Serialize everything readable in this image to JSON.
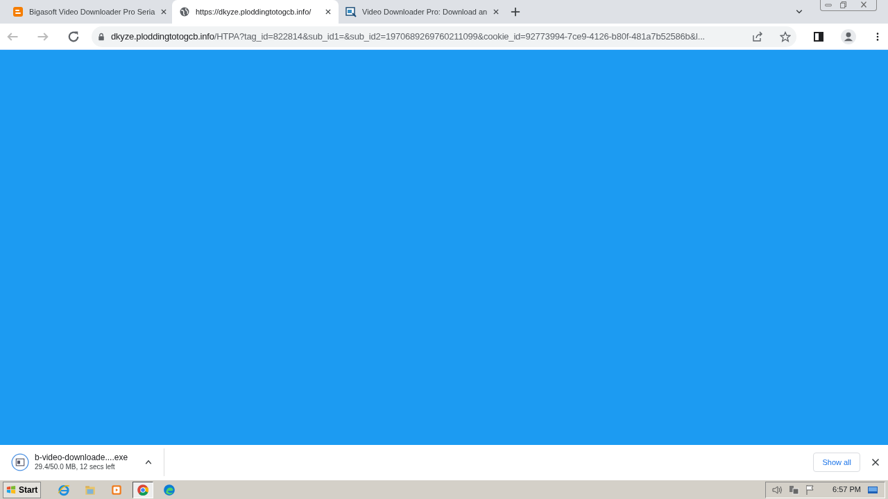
{
  "tabs": [
    {
      "title": "Bigasoft Video Downloader Pro Seria",
      "kind": "blogger",
      "selected": false
    },
    {
      "title": "https://dkyze.ploddingtotogcb.info/",
      "kind": "globe",
      "selected": true
    },
    {
      "title": "Video Downloader Pro: Download an",
      "kind": "app",
      "selected": false
    }
  ],
  "address_bar": {
    "host": "dkyze.ploddingtotogcb.info",
    "path": "/HTPA?tag_id=822814&sub_id1=&sub_id2=1970689269760211099&cookie_id=92773994-7ce9-4126-b80f-481a7b52586b&l..."
  },
  "download_bar": {
    "file_name": "b-video-downloade....exe",
    "status": "29.4/50.0 MB, 12 secs left",
    "show_all": "Show all"
  },
  "taskbar": {
    "start": "Start",
    "apps": [
      {
        "kind": "ie",
        "selected": false
      },
      {
        "kind": "folder",
        "selected": false
      },
      {
        "kind": "media",
        "selected": false
      },
      {
        "kind": "chrome",
        "selected": true
      },
      {
        "kind": "edge",
        "selected": false
      }
    ],
    "clock": "6:57 PM"
  }
}
